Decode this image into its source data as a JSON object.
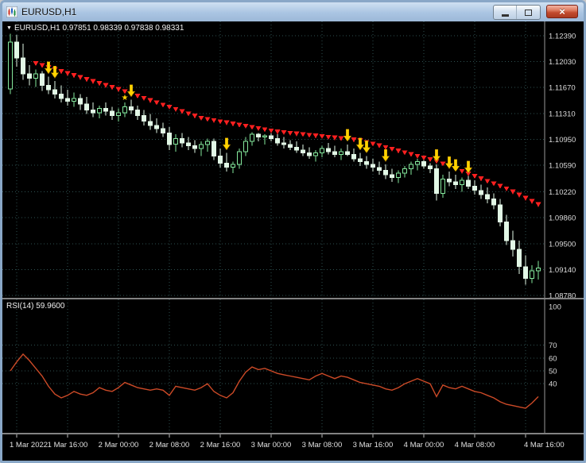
{
  "window": {
    "title": "EURUSD,H1",
    "close_glyph": "×"
  },
  "main_pane": {
    "dropdown_glyph": "▼",
    "ohlc_label": "EURUSD,H1 0.97851 0.98339 0.97838 0.98331"
  },
  "rsi_pane": {
    "label": "RSI(14) 59.9600"
  },
  "chart_data": {
    "type": "candlestick",
    "symbol": "EURUSD",
    "timeframe": "H1",
    "ohlc_display": {
      "open": "0.97851",
      "high": "0.98339",
      "low": "0.97838",
      "close": "0.98331"
    },
    "price_axis_labels": [
      "1.12390",
      "1.12030",
      "1.11670",
      "1.11310",
      "1.10950",
      "1.10590",
      "1.10220",
      "1.09860",
      "1.09500",
      "1.09140",
      "1.08780"
    ],
    "price_range": [
      1.0878,
      1.1239
    ],
    "time_labels": [
      "1 Mar 2022",
      "1 Mar 16:00",
      "2 Mar 00:00",
      "2 Mar 08:00",
      "2 Mar 16:00",
      "3 Mar 00:00",
      "3 Mar 08:00",
      "3 Mar 16:00",
      "4 Mar 00:00",
      "4 Mar 08:00",
      "4 Mar 16:00"
    ],
    "time_label_indices": [
      1,
      9,
      17,
      25,
      33,
      41,
      49,
      57,
      65,
      73,
      81
    ],
    "candles": [
      [
        1.1165,
        1.1242,
        1.1158,
        1.123
      ],
      [
        1.123,
        1.124,
        1.1196,
        1.1208
      ],
      [
        1.1208,
        1.1228,
        1.1178,
        1.1186
      ],
      [
        1.1186,
        1.1198,
        1.117,
        1.118
      ],
      [
        1.118,
        1.1192,
        1.1168,
        1.1186
      ],
      [
        1.1186,
        1.119,
        1.1162,
        1.117
      ],
      [
        1.117,
        1.1182,
        1.1158,
        1.1164
      ],
      [
        1.1164,
        1.1176,
        1.1152,
        1.1158
      ],
      [
        1.1158,
        1.117,
        1.1146,
        1.1152
      ],
      [
        1.1152,
        1.1164,
        1.1142,
        1.1148
      ],
      [
        1.1148,
        1.116,
        1.114,
        1.1152
      ],
      [
        1.1152,
        1.1158,
        1.1136,
        1.1144
      ],
      [
        1.1144,
        1.1154,
        1.113,
        1.1136
      ],
      [
        1.1136,
        1.1146,
        1.1126,
        1.1132
      ],
      [
        1.1132,
        1.1142,
        1.1124,
        1.1138
      ],
      [
        1.1138,
        1.1146,
        1.1128,
        1.1134
      ],
      [
        1.1134,
        1.114,
        1.1122,
        1.1128
      ],
      [
        1.1128,
        1.1138,
        1.112,
        1.1132
      ],
      [
        1.1132,
        1.1146,
        1.1126,
        1.114
      ],
      [
        1.114,
        1.115,
        1.113,
        1.1136
      ],
      [
        1.1136,
        1.1142,
        1.1122,
        1.1128
      ],
      [
        1.1128,
        1.1136,
        1.1114,
        1.112
      ],
      [
        1.112,
        1.113,
        1.1108,
        1.1114
      ],
      [
        1.1114,
        1.1124,
        1.1104,
        1.111
      ],
      [
        1.111,
        1.1118,
        1.1098,
        1.1104
      ],
      [
        1.1104,
        1.1112,
        1.108,
        1.1088
      ],
      [
        1.1088,
        1.1102,
        1.1078,
        1.1096
      ],
      [
        1.1096,
        1.1104,
        1.1084,
        1.109
      ],
      [
        1.109,
        1.1098,
        1.108,
        1.1086
      ],
      [
        1.1086,
        1.1094,
        1.1076,
        1.1082
      ],
      [
        1.1082,
        1.1092,
        1.1072,
        1.1088
      ],
      [
        1.1088,
        1.1096,
        1.1078,
        1.1092
      ],
      [
        1.1092,
        1.1096,
        1.1066,
        1.1072
      ],
      [
        1.1072,
        1.1082,
        1.1056,
        1.1062
      ],
      [
        1.1062,
        1.1076,
        1.105,
        1.1056
      ],
      [
        1.1056,
        1.1064,
        1.1048,
        1.106
      ],
      [
        1.106,
        1.1082,
        1.1054,
        1.1078
      ],
      [
        1.1078,
        1.1098,
        1.1072,
        1.1092
      ],
      [
        1.1092,
        1.1105,
        1.1086,
        1.1102
      ],
      [
        1.1102,
        1.1104,
        1.1092,
        1.1098
      ],
      [
        1.1098,
        1.1102,
        1.1088,
        1.11
      ],
      [
        1.11,
        1.1103,
        1.1092,
        1.1096
      ],
      [
        1.1096,
        1.1102,
        1.1086,
        1.109
      ],
      [
        1.109,
        1.1098,
        1.1082,
        1.1088
      ],
      [
        1.1088,
        1.1094,
        1.108,
        1.1084
      ],
      [
        1.1084,
        1.1092,
        1.1076,
        1.108
      ],
      [
        1.108,
        1.1088,
        1.1072,
        1.1076
      ],
      [
        1.1076,
        1.1084,
        1.1068,
        1.1072
      ],
      [
        1.1072,
        1.108,
        1.1064,
        1.1076
      ],
      [
        1.1076,
        1.1086,
        1.107,
        1.1082
      ],
      [
        1.1082,
        1.109,
        1.1074,
        1.1078
      ],
      [
        1.1078,
        1.1086,
        1.107,
        1.1074
      ],
      [
        1.1074,
        1.1082,
        1.1066,
        1.1078
      ],
      [
        1.1078,
        1.1088,
        1.1072,
        1.1074
      ],
      [
        1.1074,
        1.1082,
        1.1064,
        1.1068
      ],
      [
        1.1068,
        1.1076,
        1.1058,
        1.1064
      ],
      [
        1.1064,
        1.1072,
        1.1054,
        1.106
      ],
      [
        1.106,
        1.1068,
        1.105,
        1.1056
      ],
      [
        1.1056,
        1.1064,
        1.1046,
        1.1052
      ],
      [
        1.1052,
        1.106,
        1.104,
        1.1046
      ],
      [
        1.1046,
        1.1054,
        1.1036,
        1.1042
      ],
      [
        1.1042,
        1.1052,
        1.1034,
        1.1048
      ],
      [
        1.1048,
        1.1058,
        1.1042,
        1.1054
      ],
      [
        1.1054,
        1.1064,
        1.1046,
        1.106
      ],
      [
        1.106,
        1.1068,
        1.1052,
        1.1064
      ],
      [
        1.1064,
        1.1066,
        1.1054,
        1.1058
      ],
      [
        1.1058,
        1.1062,
        1.1048,
        1.1054
      ],
      [
        1.1054,
        1.106,
        1.101,
        1.102
      ],
      [
        1.102,
        1.1046,
        1.1014,
        1.104
      ],
      [
        1.104,
        1.105,
        1.103,
        1.1036
      ],
      [
        1.1036,
        1.1046,
        1.1026,
        1.1032
      ],
      [
        1.1032,
        1.1042,
        1.1022,
        1.1038
      ],
      [
        1.1038,
        1.1044,
        1.1026,
        1.103
      ],
      [
        1.103,
        1.1038,
        1.1018,
        1.1024
      ],
      [
        1.1024,
        1.1032,
        1.1012,
        1.1018
      ],
      [
        1.1018,
        1.1028,
        1.1006,
        1.1012
      ],
      [
        1.1012,
        1.102,
        1.0998,
        1.1004
      ],
      [
        1.1004,
        1.1012,
        1.0974,
        1.098
      ],
      [
        1.098,
        1.099,
        1.0948,
        1.0954
      ],
      [
        1.0954,
        1.0968,
        1.0932,
        1.0942
      ],
      [
        1.0942,
        1.0954,
        1.0908,
        1.0918
      ],
      [
        1.0918,
        1.0934,
        1.0893,
        1.0902
      ],
      [
        1.0902,
        1.092,
        1.0895,
        1.0912
      ],
      [
        1.0912,
        1.0926,
        1.09,
        1.0916
      ]
    ],
    "trend_points": [
      [
        4,
        1.1198
      ],
      [
        17,
        1.1162
      ],
      [
        30,
        1.1122
      ],
      [
        42,
        1.1103
      ],
      [
        55,
        1.1091
      ],
      [
        67,
        1.1062
      ],
      [
        78,
        1.1024
      ],
      [
        83,
        1.1002
      ]
    ],
    "sell_arrow_indices": [
      6,
      7,
      19,
      34,
      53,
      55,
      56,
      59,
      67,
      69,
      70,
      72
    ],
    "star": {
      "index": 18,
      "glyph": "★"
    },
    "indicator": {
      "name": "RSI",
      "period": 14,
      "display_value": "59.9600",
      "axis_labels": [
        100,
        70,
        60,
        50,
        40
      ],
      "level_lines": [
        70,
        60,
        50,
        40
      ],
      "range": [
        0,
        100
      ],
      "values": [
        50,
        57,
        63,
        58,
        52,
        46,
        38,
        32,
        29,
        31,
        34,
        32,
        31,
        33,
        37,
        35,
        34,
        37,
        41,
        39,
        37,
        36,
        35,
        36,
        35,
        31,
        38,
        37,
        36,
        35,
        37,
        40,
        34,
        31,
        29,
        33,
        42,
        49,
        53,
        51,
        52,
        50,
        48,
        47,
        46,
        45,
        44,
        43,
        46,
        48,
        46,
        44,
        46,
        45,
        43,
        41,
        40,
        39,
        38,
        36,
        35,
        37,
        40,
        42,
        44,
        42,
        40,
        30,
        39,
        37,
        36,
        38,
        36,
        34,
        33,
        31,
        29,
        26,
        24,
        23,
        22,
        21,
        25,
        30
      ]
    },
    "colors": {
      "background": "#000000",
      "grid": "#2e5151",
      "bull": "#84e89c",
      "bear": "#e2f8e6",
      "trend_marker": "#ff2020",
      "signal_arrow": "#ffd400",
      "rsi_line": "#cc4a27",
      "axis_text": "#dcdcdc",
      "separator": "#828282"
    }
  }
}
